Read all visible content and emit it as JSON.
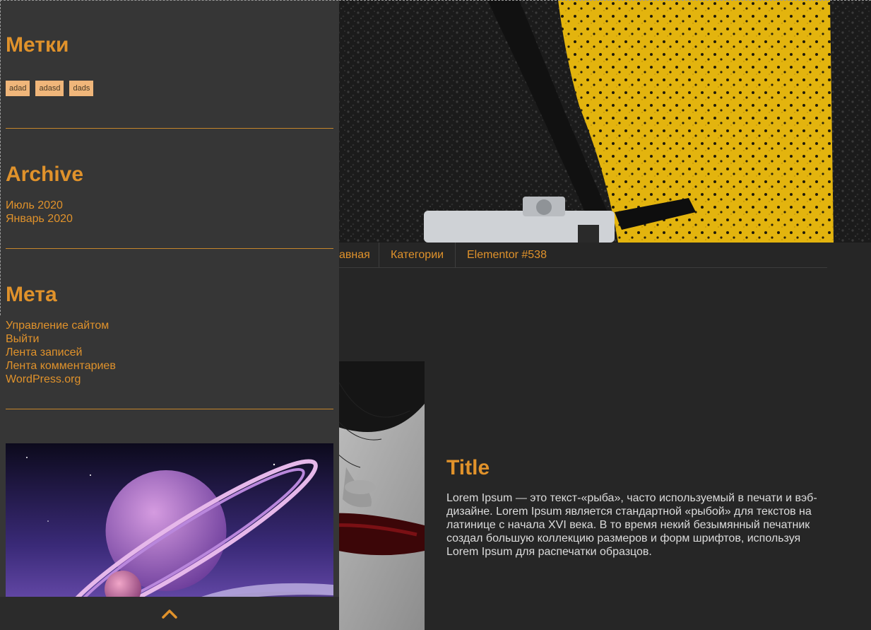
{
  "theme": {
    "accent": "#e0922b",
    "background": "#262626",
    "panel": "#363636",
    "tag_bg": "#f0b67a"
  },
  "nav": {
    "items": [
      {
        "label": "авная"
      },
      {
        "label": "Категории"
      },
      {
        "label": "Elementor #538"
      }
    ]
  },
  "post": {
    "title": "Title",
    "body": "Lorem Ipsum — это текст-«рыба», часто используемый в печати и вэб-дизайне. Lorem Ipsum является стандартной «рыбой» для текстов на латинице с начала XVI века. В то время некий безымянный печатник создал большую коллекцию размеров и форм шрифтов, используя Lorem Ipsum для распечатки образцов."
  },
  "sidebar": {
    "tags": {
      "title": "Метки",
      "items": [
        {
          "label": "adad"
        },
        {
          "label": "adasd"
        },
        {
          "label": "dads"
        }
      ]
    },
    "archive": {
      "title": "Archive",
      "items": [
        {
          "label": "Июль 2020"
        },
        {
          "label": "Январь 2020"
        }
      ]
    },
    "meta": {
      "title": "Мета",
      "items": [
        {
          "label": "Управление сайтом"
        },
        {
          "label": "Выйти"
        },
        {
          "label": "Лента записей"
        },
        {
          "label": "Лента комментариев"
        },
        {
          "label": "WordPress.org"
        }
      ]
    },
    "scroll_top_icon": "chevron-up-icon"
  }
}
